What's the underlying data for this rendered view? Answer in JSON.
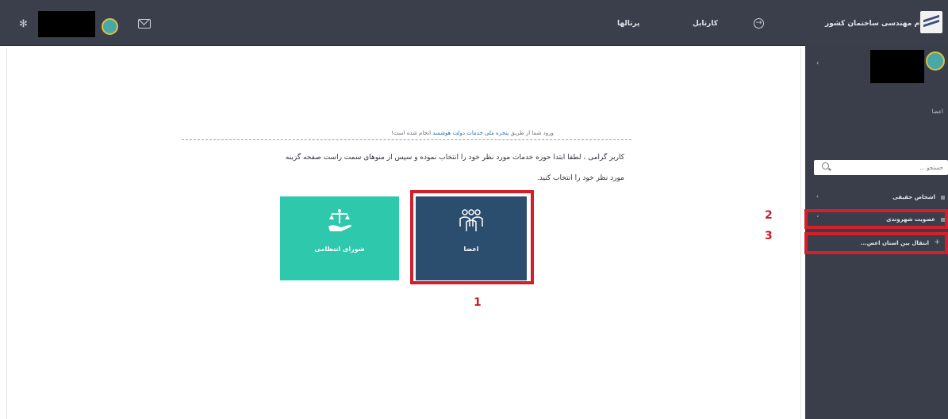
{
  "topbar": {
    "portals_label": "پرتالها",
    "kartabl_label": "کارتابل",
    "brand_label": "نظام مهندسی ساختمان کشور"
  },
  "main": {
    "notice_prefix": "ورود شما از طریق ",
    "notice_link": "پنجره ملی خدمات دولت هوشمند",
    "notice_suffix": " انجام شده است!",
    "instruction_line1": "کاربر گرامی ، لطفا ابتدا حوزه خدمات مورد نظر خود را انتخاب نموده و سپس از منوهای سمت راست صفحه گزینه",
    "instruction_line2": "مورد نظر خود را انتخاب کنید.",
    "tiles": [
      {
        "label": "شورای انتظامی",
        "icon": "scales-hand-icon",
        "color": "#2ec9ad"
      },
      {
        "label": "اعضا",
        "icon": "members-icon",
        "color": "#2b4d6e"
      }
    ]
  },
  "annotations": {
    "n1": "1",
    "n2": "2",
    "n3": "3",
    "color": "#d31f2a"
  },
  "sidebar": {
    "username": "اعضا",
    "search_placeholder": "جستجو ...",
    "items": [
      {
        "label": "اشخاص حقیقی"
      },
      {
        "label": "عضویت شهروندی"
      }
    ],
    "subitems": [
      {
        "label": "انتقال بین استان اعض..."
      }
    ]
  }
}
